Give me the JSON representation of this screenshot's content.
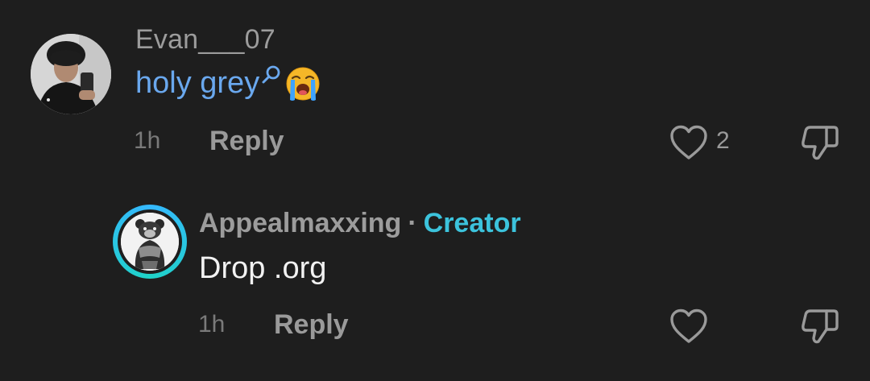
{
  "comments": [
    {
      "username": "Evan___07",
      "body_highlight": "holy grey",
      "time": "1h",
      "reply_label": "Reply",
      "like_count": "2",
      "avatar_icon": "user-photo",
      "highlight_color": "#6aa8ee"
    },
    {
      "username": "Appealmaxxing",
      "separator": "·",
      "badge": "Creator",
      "body": "Drop .org",
      "time": "1h",
      "reply_label": "Reply",
      "avatar_icon": "bear-logo",
      "badge_color": "#3cc3dc"
    }
  ],
  "icons": {
    "search": "search-icon",
    "emoji": "loudly-crying-face",
    "like": "heart-outline",
    "dislike": "thumbs-down-outline"
  }
}
